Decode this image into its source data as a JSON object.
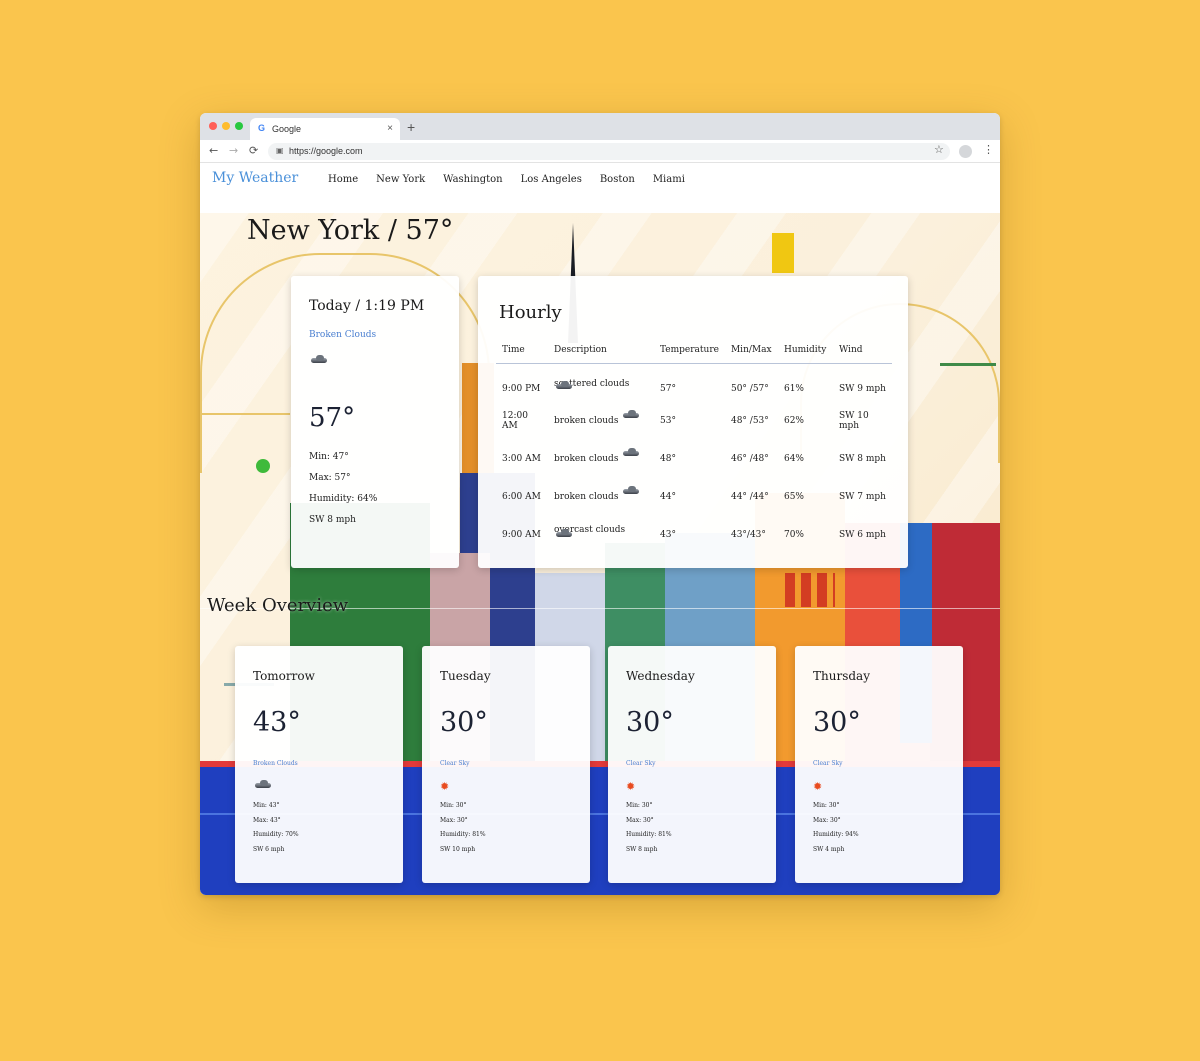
{
  "browser": {
    "tab_title": "Google",
    "tab_close": "×",
    "new_tab": "+",
    "url": "https://google.com",
    "back": "←",
    "forward": "→",
    "reload": "⟳",
    "star": "☆",
    "menu": "⋮",
    "lock": "🔒"
  },
  "site": {
    "brand": "My Weather",
    "nav": [
      "Home",
      "New York",
      "Washington",
      "Los Angeles",
      "Boston",
      "Miami"
    ]
  },
  "current": {
    "title": "New York / 57°",
    "header": "Today / 1:19 PM",
    "description": "Broken Clouds",
    "icon": "broken-clouds-icon",
    "temp": "57°",
    "min": "Min: 47°",
    "max": "Max: 57°",
    "humidity": "Humidity: 64%",
    "wind": "SW 8 mph"
  },
  "hourly": {
    "title": "Hourly",
    "columns": [
      "Time",
      "Description",
      "Temperature",
      "Min/Max",
      "Humidity",
      "Wind"
    ],
    "rows": [
      {
        "time": "9:00 PM",
        "desc": "scattered clouds",
        "temp": "57°",
        "minmax": "50° /57°",
        "humidity": "61%",
        "wind": "SW 9 mph",
        "icon": "scattered-clouds-icon"
      },
      {
        "time": "12:00 AM",
        "desc": "broken clouds",
        "temp": "53°",
        "minmax": "48° /53°",
        "humidity": "62%",
        "wind": "SW 10 mph",
        "icon": "broken-clouds-icon"
      },
      {
        "time": "3:00 AM",
        "desc": "broken clouds",
        "temp": "48°",
        "minmax": "46° /48°",
        "humidity": "64%",
        "wind": "SW 8 mph",
        "icon": "broken-clouds-icon"
      },
      {
        "time": "6:00 AM",
        "desc": "broken clouds",
        "temp": "44°",
        "minmax": "44° /44°",
        "humidity": "65%",
        "wind": "SW 7 mph",
        "icon": "broken-clouds-icon"
      },
      {
        "time": "9:00 AM",
        "desc": "overcast clouds",
        "temp": "43°",
        "minmax": "43°/43°",
        "humidity": "70%",
        "wind": "SW 6 mph",
        "icon": "overcast-clouds-icon"
      }
    ]
  },
  "week": {
    "title": "Week Overview",
    "days": [
      {
        "day": "Tomorrow",
        "temp": "43°",
        "desc": "Broken Clouds",
        "icon": "broken-clouds-icon",
        "min": "Min: 43°",
        "max": "Max: 43°",
        "humidity": "Humidity: 70%",
        "wind": "SW 6 mph"
      },
      {
        "day": "Tuesday",
        "temp": "30°",
        "desc": "Clear Sky",
        "icon": "sun-icon",
        "min": "Min: 30°",
        "max": "Max: 30°",
        "humidity": "Humidity: 81%",
        "wind": "SW 10 mph"
      },
      {
        "day": "Wednesday",
        "temp": "30°",
        "desc": "Clear Sky",
        "icon": "sun-icon",
        "min": "Min: 30°",
        "max": "Max: 30°",
        "humidity": "Humidity: 81%",
        "wind": "SW 8 mph"
      },
      {
        "day": "Thursday",
        "temp": "30°",
        "desc": "Clear Sky",
        "icon": "sun-icon",
        "min": "Min: 30°",
        "max": "Max: 30°",
        "humidity": "Humidity: 94%",
        "wind": "SW 4 mph"
      }
    ]
  },
  "colors": {
    "page_bg": "#fac54d",
    "brand": "#4a90d9",
    "desc_link": "#4a7fd0",
    "temp_text": "#1c2233"
  }
}
